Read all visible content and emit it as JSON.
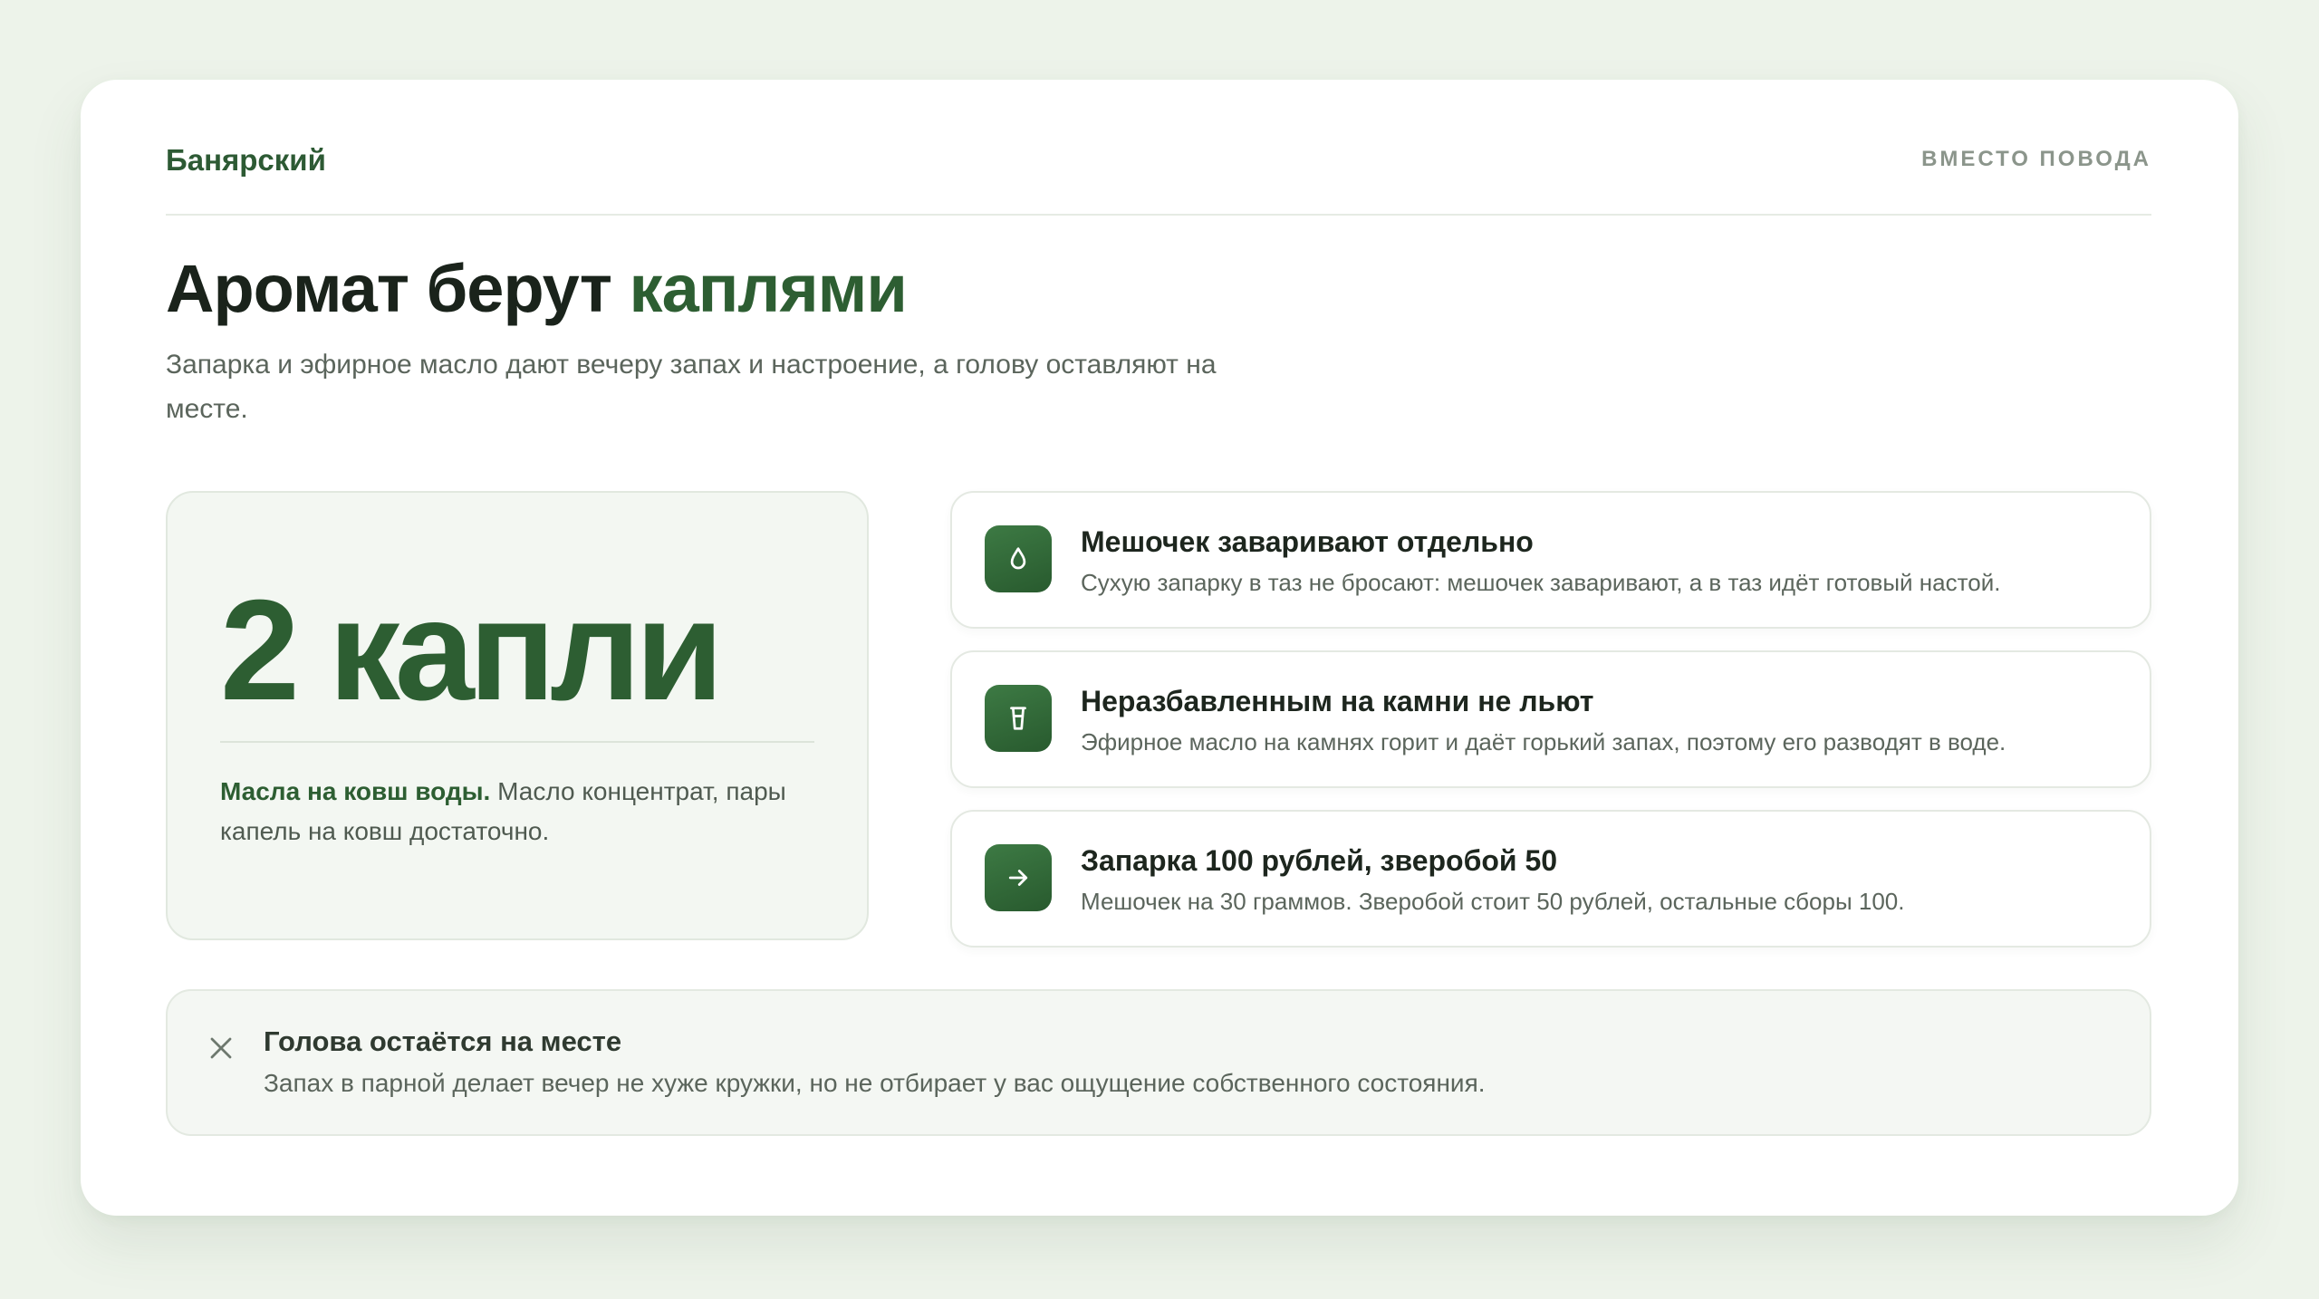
{
  "header": {
    "brand": "Банярский",
    "tagline": "ВМЕСТО ПОВОДА"
  },
  "hero": {
    "title_main": "Аромат берут ",
    "title_accent": "каплями",
    "subtitle": "Запарка и эфирное масло дают вечеру запах и настроение, а голову оставляют на месте."
  },
  "stat": {
    "value": "2 капли",
    "lead": "Масла на ковш воды.",
    "text": " Масло концентрат, пары капель на ковш достаточно."
  },
  "features": [
    {
      "icon": "drop-icon",
      "title": "Мешочек заваривают отдельно",
      "desc": "Сухую запарку в таз не бросают: мешочек заваривают, а в таз идёт готовый настой."
    },
    {
      "icon": "glass-icon",
      "title": "Неразбавленным на камни не льют",
      "desc": "Эфирное масло на камнях горит и даёт горький запах, поэтому его разводят в воде."
    },
    {
      "icon": "arrow-right-icon",
      "title": "Запарка 100 рублей, зверобой 50",
      "desc": "Мешочек на 30 граммов. Зверобой стоит 50 рублей, остальные сборы 100."
    }
  ],
  "note": {
    "icon": "close-icon",
    "title": "Голова остаётся на месте",
    "desc": "Запах в парной делает вечер не хуже кружки, но не отбирает у вас ощущение собственного состояния."
  },
  "colors": {
    "accent": "#2d5e32",
    "background": "#edf3ea",
    "card": "#ffffff"
  }
}
